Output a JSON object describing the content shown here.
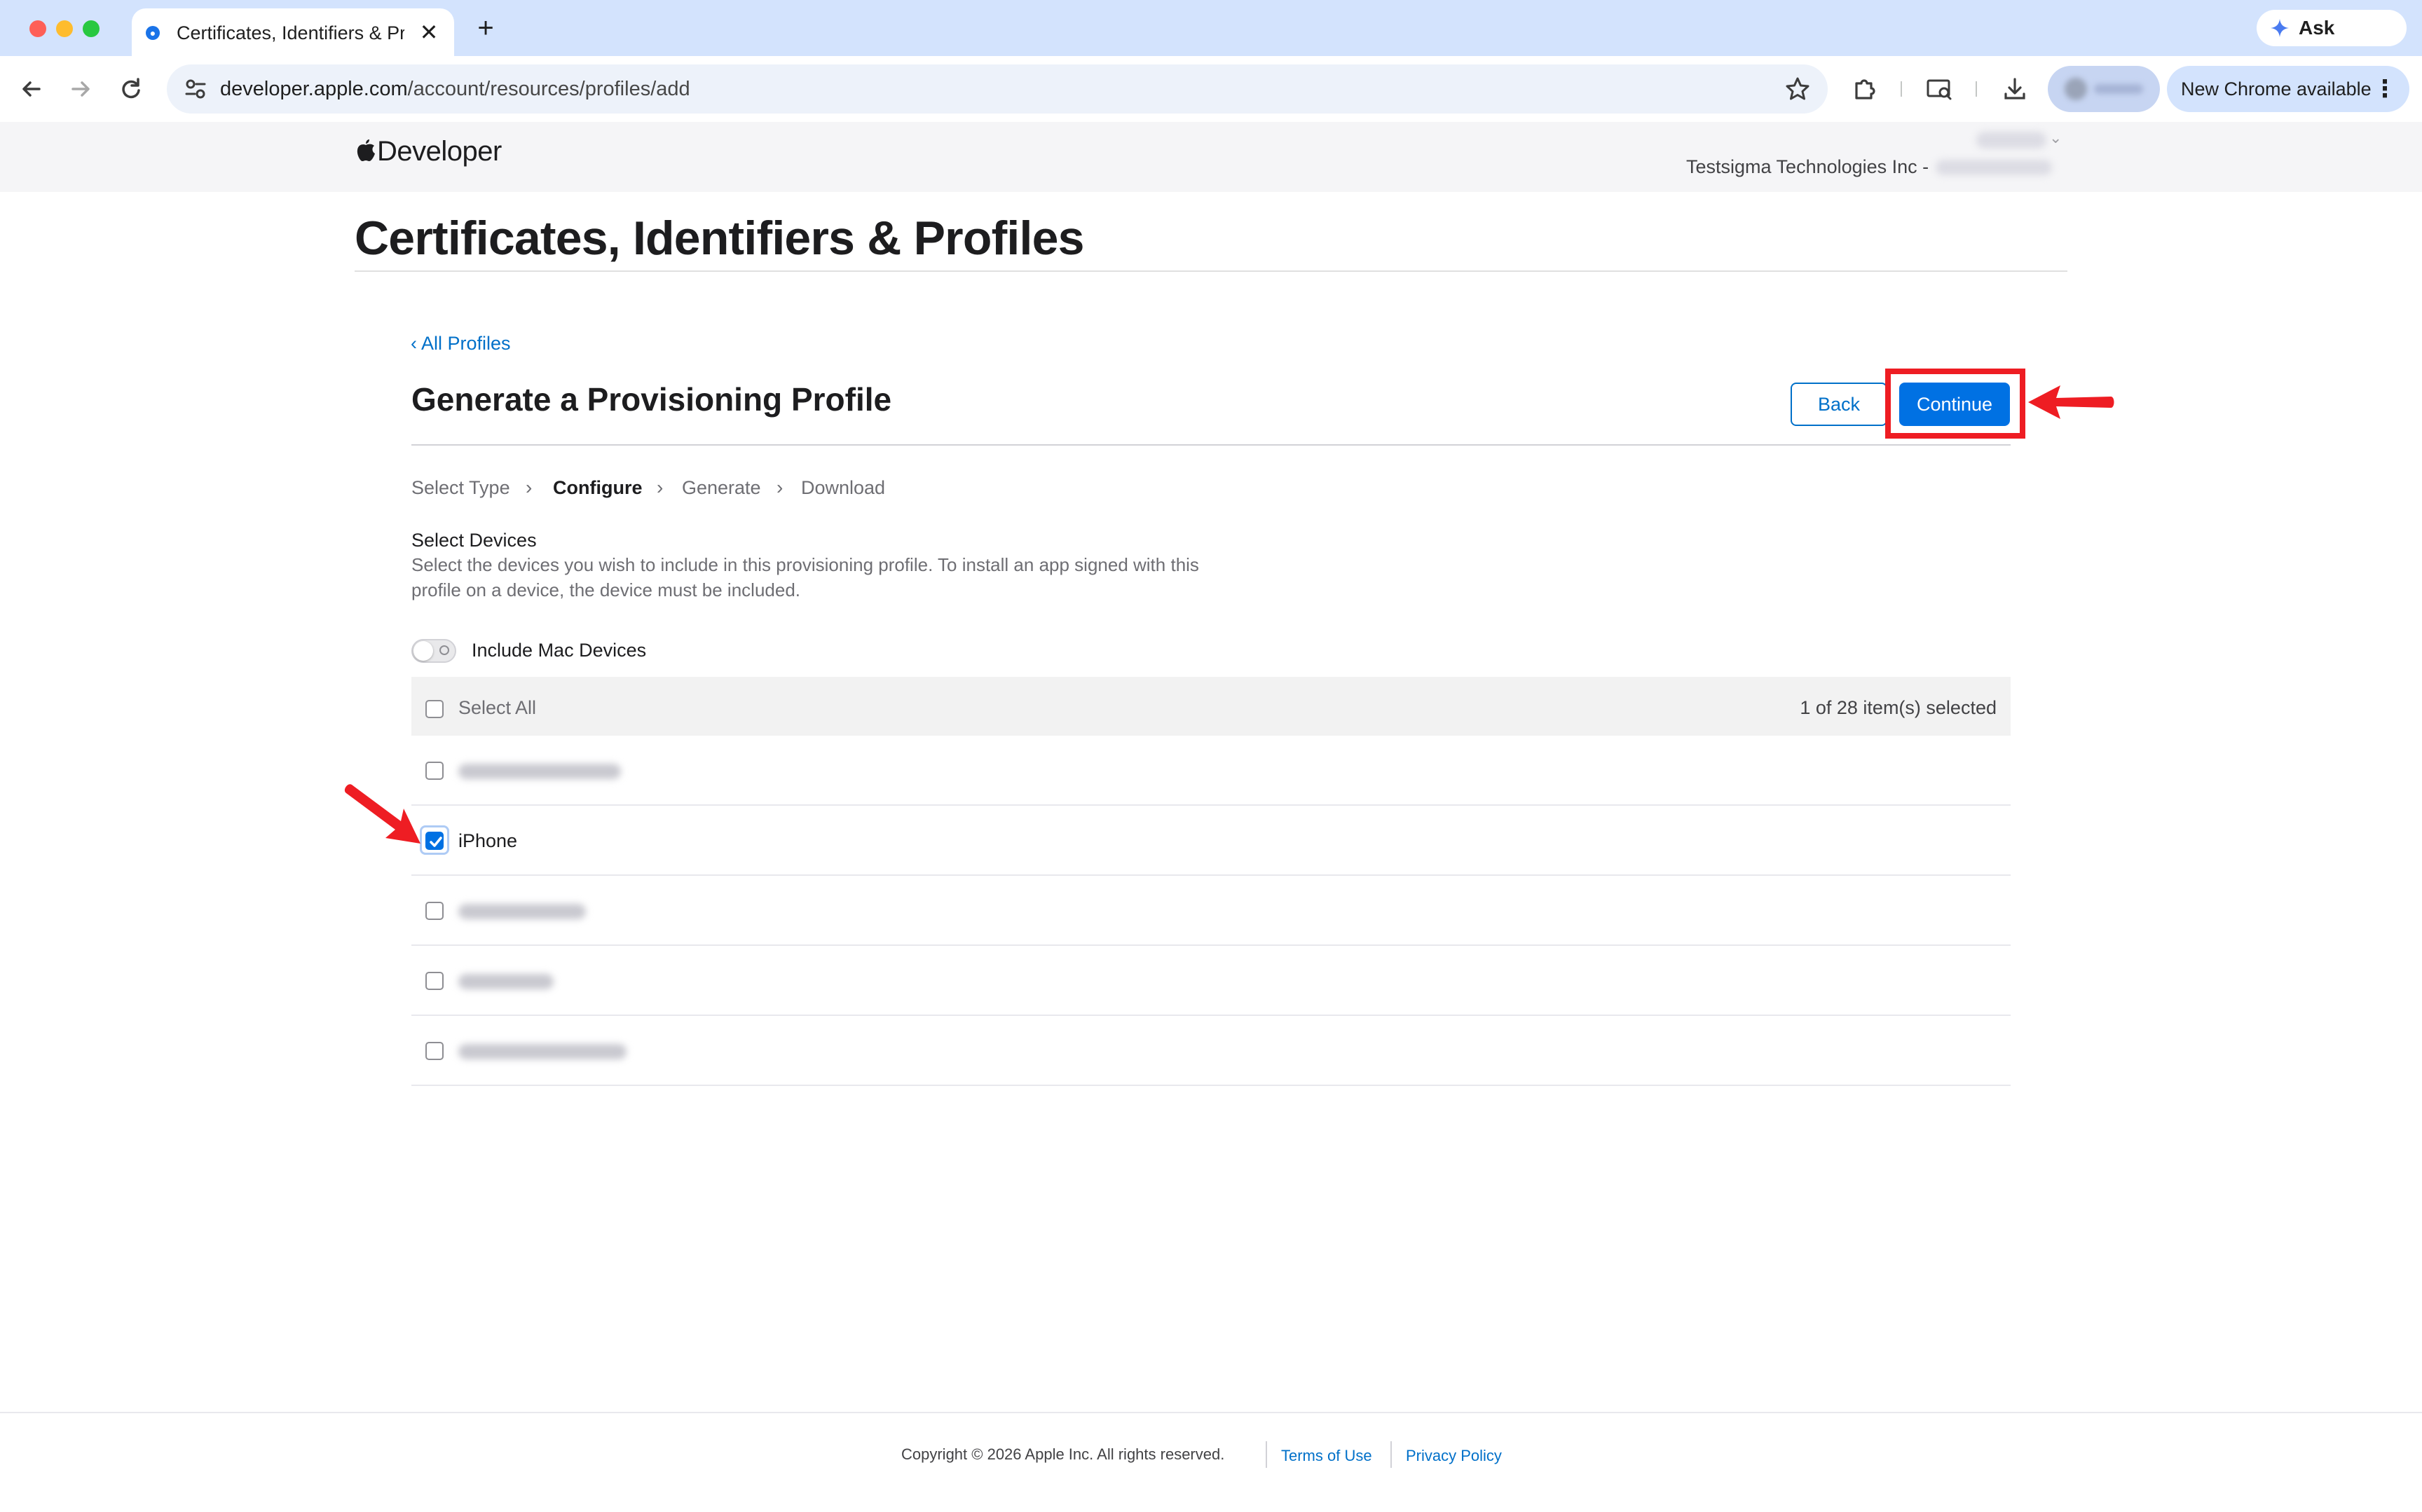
{
  "browser": {
    "tab_title": "Certificates, Identifiers & Profiles",
    "tab_close": "✕",
    "new_tab": "+",
    "url_host": "developer.apple.com",
    "url_path": "/account/resources/profiles/add",
    "ask_gemini": "Ask Gemini",
    "new_chrome": "New Chrome available",
    "menu_dots": "⋮"
  },
  "header": {
    "brand": "Developer",
    "team_label": "Testsigma Technologies Inc -"
  },
  "page": {
    "title": "Certificates, Identifiers & Profiles",
    "back_link": "‹ All Profiles",
    "section_title": "Generate a Provisioning Profile",
    "back_button": "Back",
    "continue_button": "Continue",
    "steps": [
      "Select Type",
      "Configure",
      "Generate",
      "Download"
    ],
    "step_separator": "›",
    "active_step": "Configure",
    "devices_heading": "Select Devices",
    "devices_description": "Select the devices you wish to include in this provisioning profile. To install an app signed with this profile on a device, the device must be included.",
    "include_mac_label": "Include Mac Devices",
    "include_mac_on": false,
    "select_all_label": "Select All",
    "selection_count": "1 of 28 item(s) selected",
    "devices": [
      {
        "name": "",
        "checked": false,
        "blurred": true
      },
      {
        "name": "iPhone",
        "checked": true,
        "blurred": false
      },
      {
        "name": "",
        "checked": false,
        "blurred": true
      },
      {
        "name": "",
        "checked": false,
        "blurred": true
      },
      {
        "name": "",
        "checked": false,
        "blurred": true
      }
    ]
  },
  "footer": {
    "copyright": "Copyright © 2026 Apple Inc. All rights reserved.",
    "terms": "Terms of Use",
    "privacy": "Privacy Policy"
  },
  "colors": {
    "accent": "#0071e3",
    "link": "#0070c9",
    "annotation": "#ee1d23"
  }
}
